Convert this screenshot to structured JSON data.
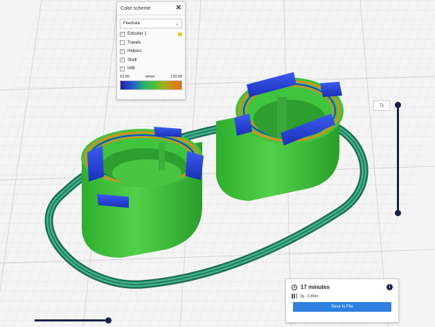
{
  "color_scheme_panel": {
    "title": "Color scheme",
    "close_icon": "close-icon",
    "selected_scheme": "Feedrate",
    "dropdown_icon": "chevron-down-icon",
    "items": [
      {
        "label": "Extruder 1",
        "checked": true,
        "swatch_color": "#f5c518"
      },
      {
        "label": "Travels",
        "checked": false
      },
      {
        "label": "Helpers",
        "checked": true
      },
      {
        "label": "Shell",
        "checked": true
      },
      {
        "label": "Infill",
        "checked": true
      }
    ],
    "range_min": "10.00",
    "range_unit": "mm/s",
    "range_max": "120.00"
  },
  "layer_slider": {
    "value": "71"
  },
  "print_card": {
    "time": "17 minutes",
    "material": "3g · 0.89m",
    "save_label": "Save to File",
    "clock_icon": "clock-icon",
    "info_icon": "info-icon",
    "spool_icon": "spool-icon"
  },
  "colors": {
    "accent": "#2f7fe0",
    "slider": "#14214a",
    "model_green": "#3fc43f",
    "brim_teal": "#2e9e78",
    "top_blue": "#1f3fd8"
  }
}
